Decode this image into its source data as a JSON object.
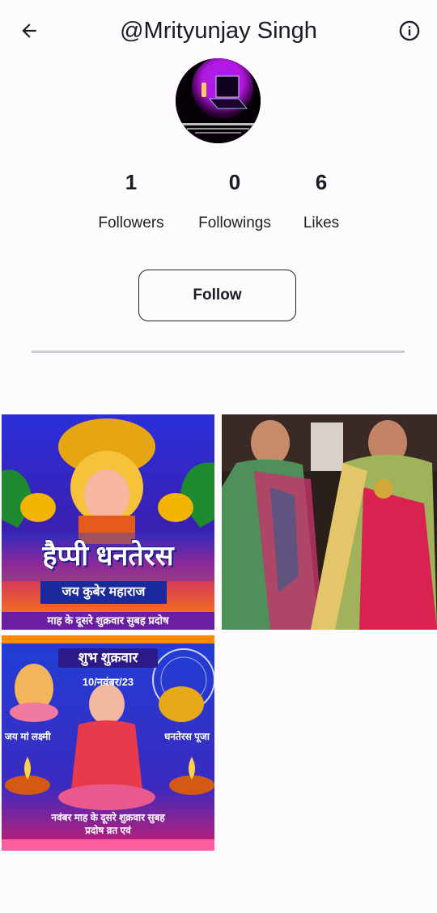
{
  "header": {
    "title": "@Mrityunjay Singh",
    "back_icon": "arrow-back-icon",
    "info_icon": "info-icon"
  },
  "avatar": {
    "caption": "Computer Kaam Kar Raha Hai - Dekho Hisaab"
  },
  "stats": [
    {
      "value": "1",
      "label": "Followers"
    },
    {
      "value": "0",
      "label": "Followings"
    },
    {
      "value": "6",
      "label": "Likes"
    }
  ],
  "follow_button": {
    "label": "Follow"
  },
  "posts": [
    {
      "banner": "हैप्पी धनतेरस",
      "subtitle": "जय कुबेर महाराज",
      "footer": "माह के दूसरे शुक्रवार सुबह प्रदोष"
    },
    {
      "caption": ""
    },
    {
      "header": "शुभ शुक्रवार",
      "date": "10/नवंबर/23",
      "left_label": "जय मां लक्ष्मी",
      "right_label": "धनतेरस पूजा",
      "footer1": "नवंबर माह के दूसरे शुक्रवार सुबह",
      "footer2": "प्रदोष व्रत एवं"
    }
  ],
  "colors": {
    "background": "#fefbff",
    "text": "#1c1b1f",
    "divider": "#cfcdd3"
  }
}
